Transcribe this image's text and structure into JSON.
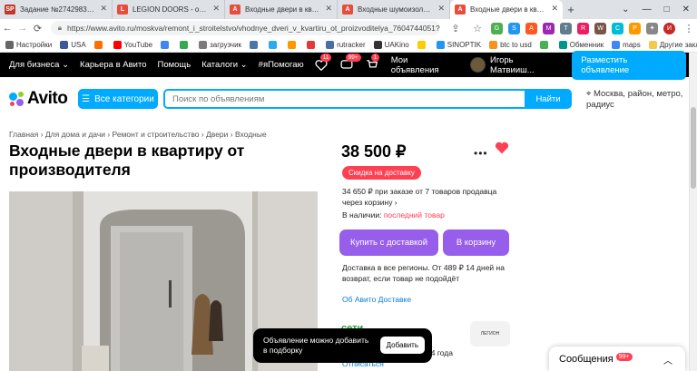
{
  "browser": {
    "tabs": [
      {
        "label": "Задание №2742983 - просмо",
        "favicon": "SP",
        "color": "#c0392b"
      },
      {
        "label": "LEGION DOORS - официальны",
        "favicon": "L",
        "color": "#e74c3c"
      },
      {
        "label": "Входные двери в квартиру St",
        "favicon": "A",
        "color": "#e74c3c"
      },
      {
        "label": "Входные шумоизоляционные",
        "favicon": "A",
        "color": "#e74c3c"
      },
      {
        "label": "Входные двери в квартиру от",
        "favicon": "A",
        "color": "#e74c3c",
        "active": true
      }
    ],
    "new_tab": "+",
    "window_controls": [
      "⌄",
      "—",
      "□",
      "✕"
    ],
    "url": "https://www.avito.ru/moskva/remont_i_stroitelstvo/vhodnye_dveri_v_kvartiru_ot_proizvoditelya_7604744051?slocation=621540...",
    "bookmarks": [
      {
        "label": "Настройки",
        "color": "#666"
      },
      {
        "label": "USA",
        "color": "#3b5998"
      },
      {
        "label": "",
        "color": "#ff6f00"
      },
      {
        "label": "YouTube",
        "color": "#ff0000"
      },
      {
        "label": "",
        "color": "#4285f4"
      },
      {
        "label": "",
        "color": "#34a853"
      },
      {
        "label": "загрузчик",
        "color": "#7b7b7b"
      },
      {
        "label": "",
        "color": "#4a76a8"
      },
      {
        "label": "",
        "color": "#2aabee"
      },
      {
        "label": "",
        "color": "#ff9800"
      },
      {
        "label": "",
        "color": "#e53935"
      },
      {
        "label": "rutracker",
        "color": "#4a6fa5"
      },
      {
        "label": "UAKino",
        "color": "#333"
      },
      {
        "label": "",
        "color": "#ffcc00"
      },
      {
        "label": "SINOPTIK",
        "color": "#2196f3"
      },
      {
        "label": "btc to usd",
        "color": "#f7931a"
      },
      {
        "label": "",
        "color": "#4caf50"
      },
      {
        "label": "Обменник",
        "color": "#009688"
      },
      {
        "label": "maps",
        "color": "#4285f4"
      }
    ],
    "bookmarks_other": "Другие закладки"
  },
  "avito_nav": {
    "for_business": "Для бизнеса",
    "career": "Карьера в Авито",
    "help": "Помощь",
    "catalogs": "Каталоги",
    "help_tag": "#яПомогаю",
    "fav_count": "11",
    "msg_count": "99+",
    "cart_count": "1",
    "my_ads": "Мои объявления",
    "user_name": "Игорь Матвииш...",
    "post_ad": "Разместить объявление"
  },
  "search": {
    "logo": "Avito",
    "categories": "Все категории",
    "placeholder": "Поиск по объявлениям",
    "find": "Найти",
    "location": "Москва, район, метро, радиус"
  },
  "breadcrumb": "Главная › Для дома и дачи › Ремонт и строительство › Двери › Входные",
  "listing": {
    "title": "Входные двери в квартиру от производителя",
    "price": "38 500 ₽",
    "discount_badge": "Скидка на доставку",
    "installment": "34 650 ₽ при заказе от 7 товаров продавца через корзину ›",
    "stock_label": "В наличии:",
    "stock_value": "последний товар",
    "buy_delivery": "Купить с доставкой",
    "to_cart": "В корзину",
    "delivery_info": "Доставка в все регионы. От 489 ₽ 14 дней на возврат, если товар не подойдёт",
    "delivery_link": "Об Авито Доставке",
    "seller_name": "сети",
    "seller_logo": "ЛЕГИОН",
    "seller_year": "24 года",
    "unsubscribe": "Отписаться"
  },
  "toast": {
    "message": "Объявление можно добавить в подборку",
    "button": "Добавить"
  },
  "messages_widget": {
    "label": "Сообщения",
    "count": "99+"
  },
  "colors": {
    "accent_blue": "#00aaff",
    "purple": "#965eeb",
    "red": "#ff4053",
    "green": "#19a33c"
  }
}
